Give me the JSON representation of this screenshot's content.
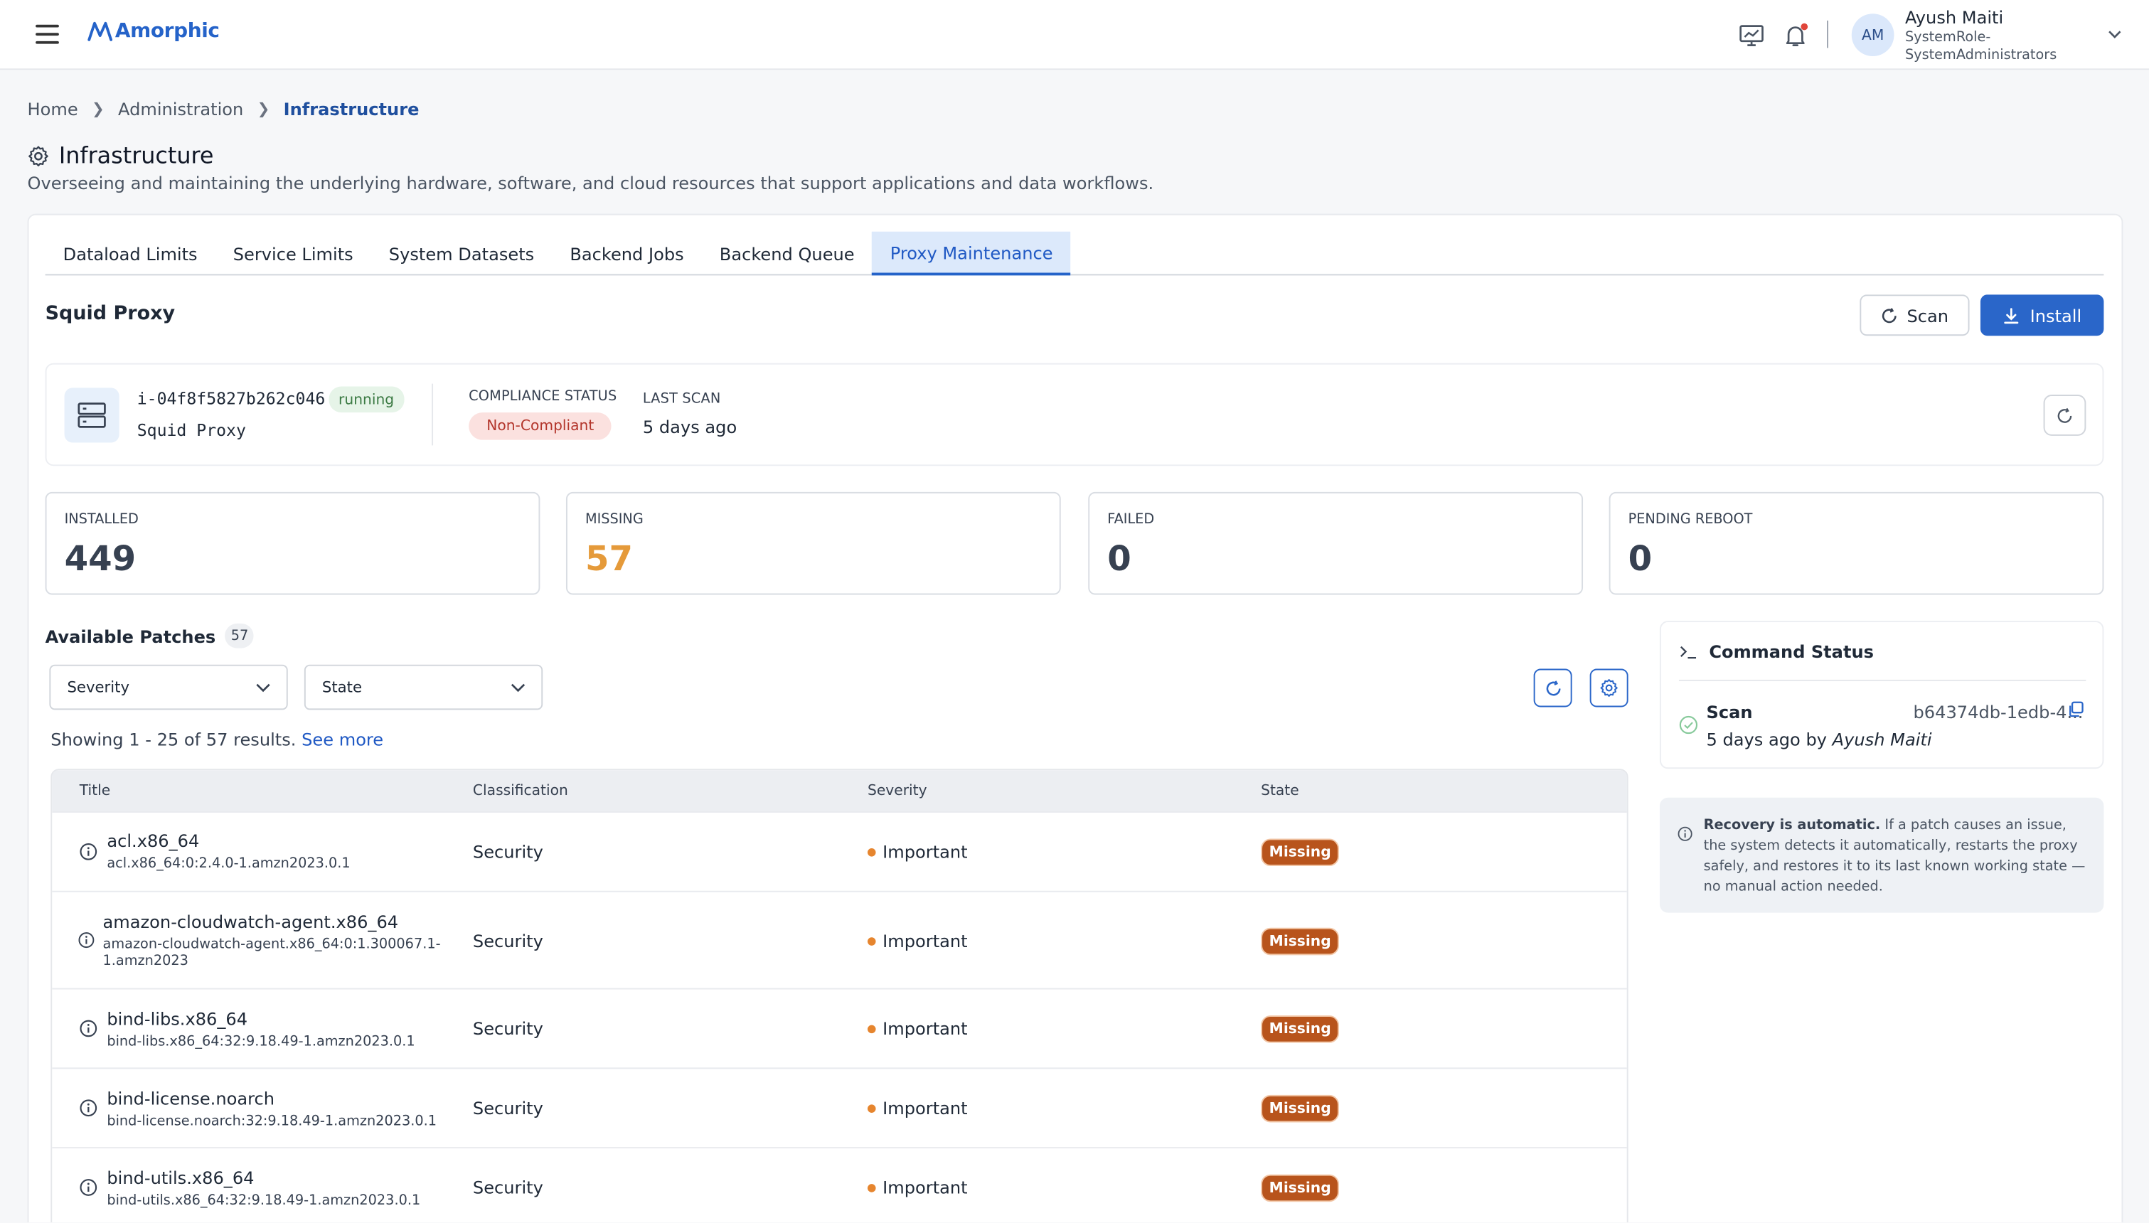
{
  "app": {
    "name": "Amorphic"
  },
  "user": {
    "initials": "AM",
    "name": "Ayush Maiti",
    "role": "SystemRole-SystemAdministrators"
  },
  "breadcrumb": [
    "Home",
    "Administration",
    "Infrastructure"
  ],
  "page": {
    "title": "Infrastructure",
    "description": "Overseeing and maintaining the underlying hardware, software, and cloud resources that support applications and data workflows."
  },
  "tabs": [
    "Dataload Limits",
    "Service Limits",
    "System Datasets",
    "Backend Jobs",
    "Backend Queue",
    "Proxy Maintenance"
  ],
  "section": {
    "title": "Squid Proxy",
    "scan_label": "Scan",
    "install_label": "Install"
  },
  "instance": {
    "id": "i-04f8f5827b262c046",
    "status": "running",
    "name": "Squid Proxy",
    "compliance_label": "COMPLIANCE STATUS",
    "compliance_value": "Non-Compliant",
    "last_scan_label": "LAST SCAN",
    "last_scan_value": "5 days ago"
  },
  "stats": [
    {
      "label": "INSTALLED",
      "value": "449"
    },
    {
      "label": "MISSING",
      "value": "57"
    },
    {
      "label": "FAILED",
      "value": "0"
    },
    {
      "label": "PENDING REBOOT",
      "value": "0"
    }
  ],
  "patches": {
    "title": "Available Patches",
    "count": "57",
    "filters": {
      "severity": "Severity",
      "state": "State"
    },
    "showing": "Showing 1 - 25 of 57 results.",
    "see_more": "See more",
    "columns": [
      "Title",
      "Classification",
      "Severity",
      "State"
    ],
    "rows": [
      {
        "title": "acl.x86_64",
        "sub1": "acl.x86_64:0:2.4.0-1.amzn2023.0.1",
        "sub2": "",
        "classification": "Security",
        "severity": "Important",
        "state": "Missing"
      },
      {
        "title": "amazon-cloudwatch-agent.x86_64",
        "sub1": "amazon-cloudwatch-agent.x86_64:0:1.300067.1-",
        "sub2": "1.amzn2023",
        "classification": "Security",
        "severity": "Important",
        "state": "Missing"
      },
      {
        "title": "bind-libs.x86_64",
        "sub1": "bind-libs.x86_64:32:9.18.49-1.amzn2023.0.1",
        "sub2": "",
        "classification": "Security",
        "severity": "Important",
        "state": "Missing"
      },
      {
        "title": "bind-license.noarch",
        "sub1": "bind-license.noarch:32:9.18.49-1.amzn2023.0.1",
        "sub2": "",
        "classification": "Security",
        "severity": "Important",
        "state": "Missing"
      },
      {
        "title": "bind-utils.x86_64",
        "sub1": "bind-utils.x86_64:32:9.18.49-1.amzn2023.0.1",
        "sub2": "",
        "classification": "Security",
        "severity": "Important",
        "state": "Missing"
      }
    ]
  },
  "command_status": {
    "title": "Command Status",
    "command": "Scan",
    "command_id": "b64374db-1edb-4...",
    "time": "5 days ago by",
    "user": "Ayush Maiti"
  },
  "note": {
    "bold": "Recovery is automatic.",
    "text": " If a patch causes an issue, the system detects it automatically, restarts the proxy safely, and restores it to its last known working state — no manual action needed."
  },
  "colors": {
    "primary": "#2a66c9",
    "missing": "#e59a3a",
    "badge_missing": "#b8541c",
    "noncompliant": "#b3352b"
  },
  "icons": [
    "menu-icon",
    "amorphic-logo-icon",
    "monitor-icon",
    "bell-icon",
    "chevron-down-icon",
    "gear-icon",
    "refresh-icon",
    "download-icon",
    "server-icon",
    "info-icon",
    "terminal-icon",
    "check-circle-icon",
    "copy-icon"
  ]
}
